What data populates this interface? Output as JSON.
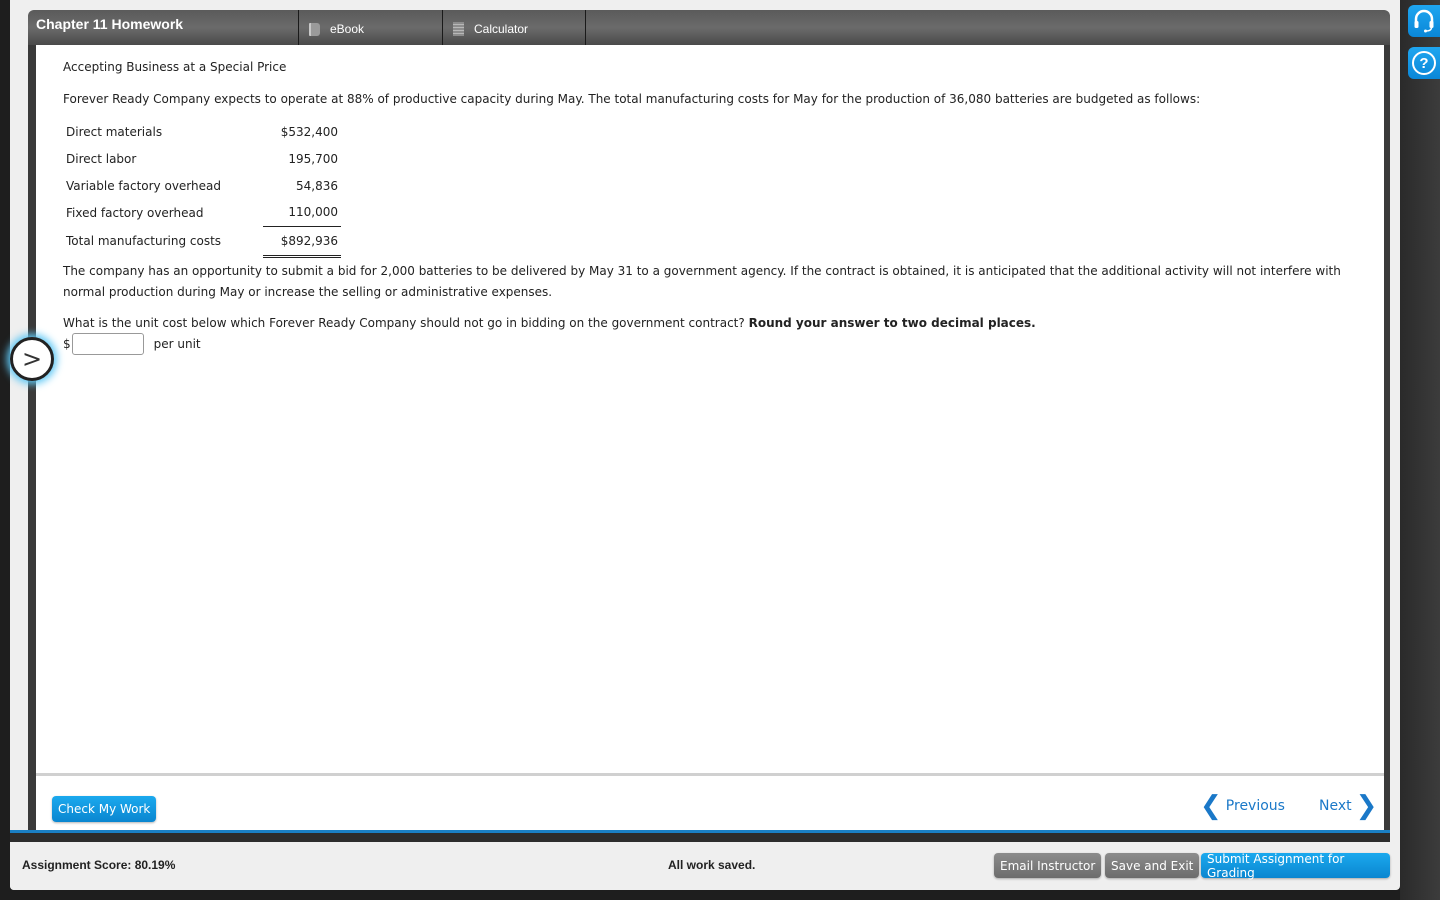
{
  "header": {
    "title": "Chapter 11 Homework",
    "tabs": [
      {
        "label": "eBook",
        "icon": "book-icon"
      },
      {
        "label": "Calculator",
        "icon": "calculator-icon"
      }
    ]
  },
  "rail": {
    "support_icon": "headset-icon",
    "help_icon": "help-icon",
    "help_glyph": "?"
  },
  "question": {
    "title": "Accepting Business at a Special Price",
    "intro": "Forever Ready Company expects to operate at 88% of productive capacity during May. The total manufacturing costs for May for the production of 36,080 batteries are budgeted as follows:",
    "costs": [
      {
        "label": "Direct materials",
        "value": "$532,400"
      },
      {
        "label": "Direct labor",
        "value": "195,700"
      },
      {
        "label": "Variable factory overhead",
        "value": "54,836"
      },
      {
        "label": "Fixed factory overhead",
        "value": "110,000"
      }
    ],
    "total": {
      "label": "Total manufacturing costs",
      "value": "$892,936"
    },
    "paragraph": "The company has an opportunity to submit a bid for 2,000 batteries to be delivered by May 31 to a government agency. If the contract is obtained, it is anticipated that the additional activity will not interfere with normal production during May or increase the selling or administrative expenses.",
    "ask": "What is the unit cost below which Forever Ready Company should not go in bidding on the government contract?",
    "ask_bold": "Round your answer to two decimal places.",
    "answer": {
      "prefix": "$",
      "value": "",
      "placeholder": "",
      "suffix": "per unit"
    }
  },
  "expand_glyph": ">",
  "bottom": {
    "check_label": "Check My Work",
    "previous_label": "Previous",
    "next_label": "Next",
    "prev_glyph": "❮",
    "next_glyph": "❯"
  },
  "footer": {
    "score": "Assignment Score: 80.19%",
    "status": "All work saved.",
    "email_label": "Email Instructor",
    "save_label": "Save and Exit",
    "submit_label": "Submit Assignment for Grading"
  },
  "colors": {
    "accent": "#0a86d0",
    "link": "#1a78c8",
    "header_bg": "#5a5a5a"
  }
}
